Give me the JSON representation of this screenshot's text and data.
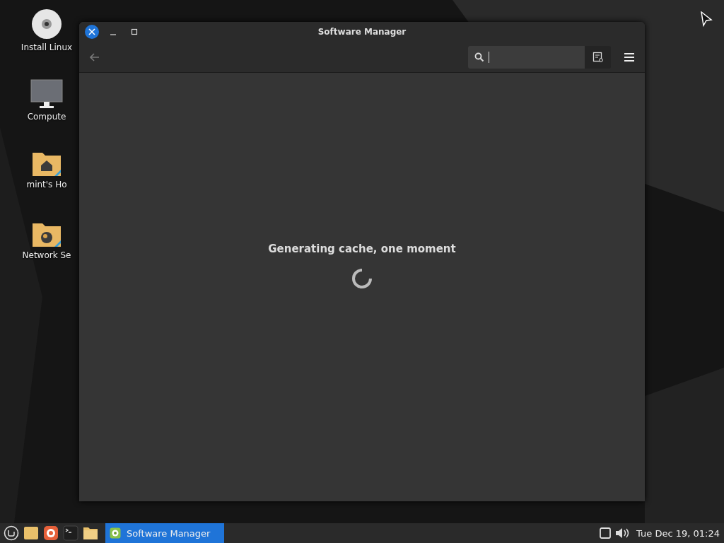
{
  "desktop": {
    "icons": [
      {
        "kind": "disc",
        "label": "Install Linux"
      },
      {
        "kind": "computer",
        "label": "Compute"
      },
      {
        "kind": "home",
        "label": "mint's Ho"
      },
      {
        "kind": "network",
        "label": "Network Se"
      }
    ]
  },
  "window": {
    "title": "Software Manager",
    "message": "Generating cache, one moment"
  },
  "taskbar": {
    "launchers": [
      {
        "kind": "menu"
      },
      {
        "kind": "folder"
      },
      {
        "kind": "browser"
      },
      {
        "kind": "terminal"
      },
      {
        "kind": "files"
      }
    ],
    "tasks": [
      {
        "label": "Software Manager",
        "selected": true
      }
    ],
    "clock": "Tue Dec 19, 01:24"
  }
}
